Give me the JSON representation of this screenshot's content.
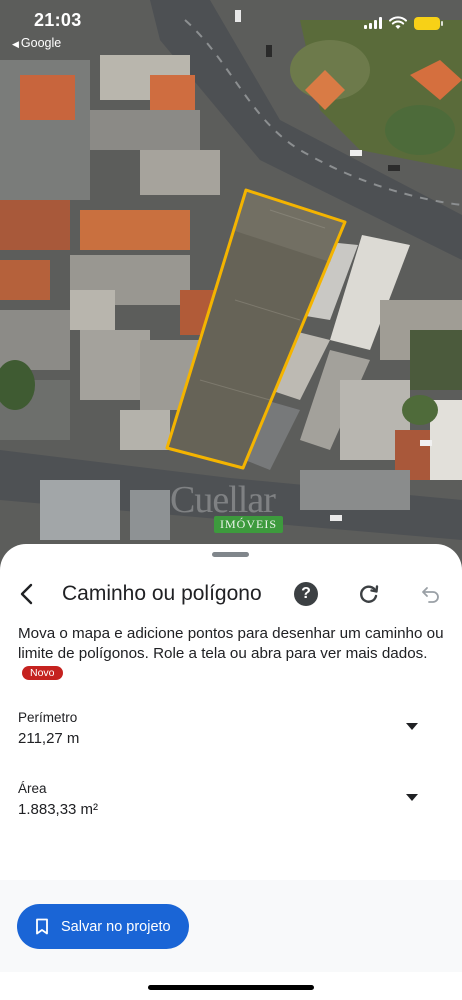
{
  "status_bar": {
    "time": "21:03",
    "back_app": "Google",
    "battery_color": "#f7d117"
  },
  "map": {
    "polygon_color": "#f4b400",
    "watermark_text": "Cuellar",
    "watermark_sub": "IMÓVEIS"
  },
  "sheet": {
    "title": "Caminho ou polígono",
    "back_icon": "chevron-left-icon",
    "help_label": "?",
    "reset_icon": "refresh-icon",
    "undo_icon": "undo-icon",
    "description": "Mova o mapa e adicione pontos para desenhar um caminho ou limite de polígonos. Role a tela ou abra para ver mais dados.",
    "badge": "Novo",
    "badge_color": "#c5221f",
    "metrics": [
      {
        "label": "Perímetro",
        "value": "211,27 m"
      },
      {
        "label": "Área",
        "value": "1.883,33 m²"
      }
    ],
    "save_label": "Salvar no projeto",
    "save_icon": "bookmark-icon",
    "accent_color": "#1a65d6"
  }
}
